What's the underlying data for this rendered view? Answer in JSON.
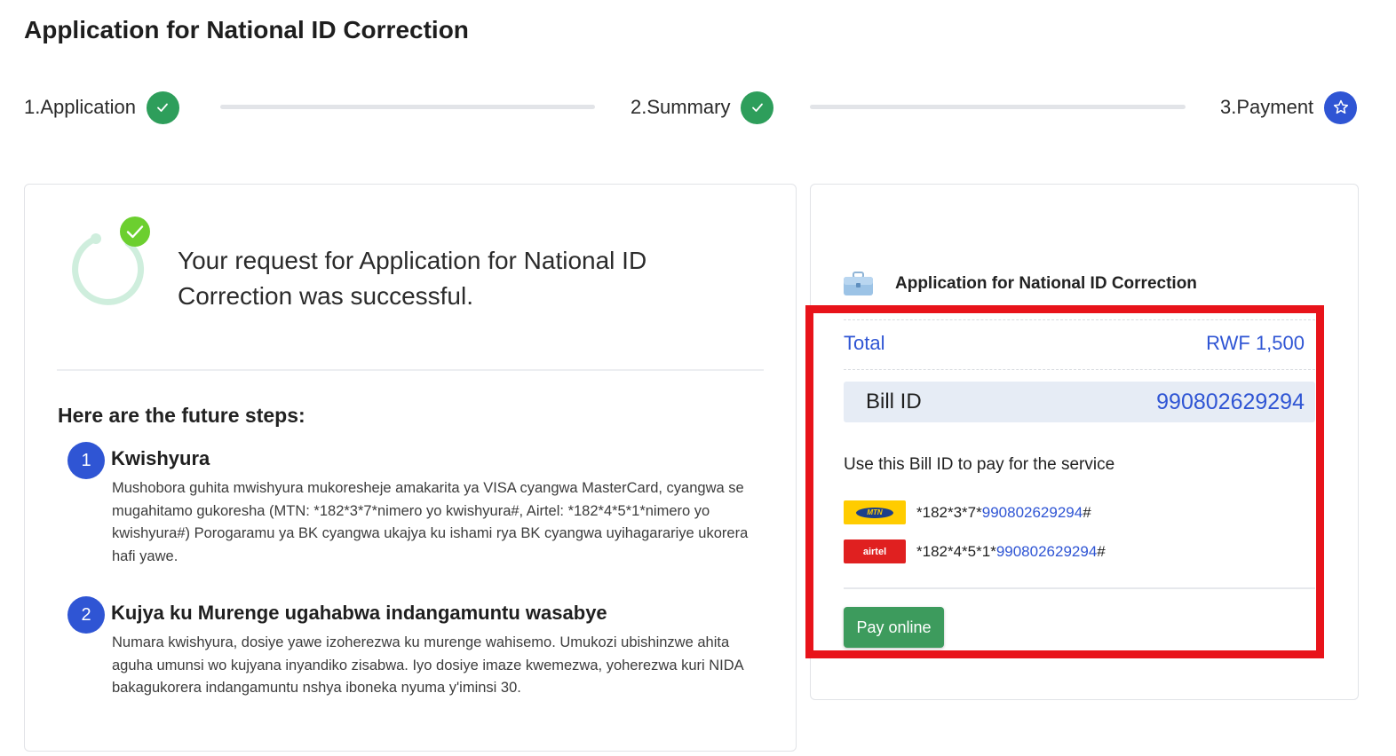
{
  "page": {
    "title": "Application for National ID Correction"
  },
  "stepper": {
    "steps": [
      {
        "label": "1.Application",
        "status": "done",
        "icon": "check-icon"
      },
      {
        "label": "2.Summary",
        "status": "done",
        "icon": "check-icon"
      },
      {
        "label": "3.Payment",
        "status": "current",
        "icon": "star-icon"
      }
    ]
  },
  "success": {
    "message": "Your request for Application for National ID Correction was successful."
  },
  "future": {
    "title": "Here are the future steps:",
    "steps": [
      {
        "number": "1",
        "title": "Kwishyura",
        "body": "Mushobora guhita mwishyura mukoresheje amakarita ya VISA cyangwa MasterCard, cyangwa se mugahitamo gukoresha (MTN: *182*3*7*nimero yo kwishyura#, Airtel: *182*4*5*1*nimero yo kwishyura#) Porogaramu ya BK cyangwa ukajya ku ishami rya BK cyangwa uyihagarariye ukorera hafi yawe."
      },
      {
        "number": "2",
        "title": "Kujya ku Murenge ugahabwa indangamuntu wasabye",
        "body": "Numara kwishyura, dosiye yawe izoherezwa ku murenge wahisemo. Umukozi ubishinzwe ahita aguha umunsi wo kujyana inyandiko zisabwa. Iyo dosiye imaze kwemezwa, yoherezwa kuri NIDA bakagukorera indangamuntu nshya iboneka nyuma y'iminsi 30."
      }
    ]
  },
  "payment": {
    "service_name": "Application for National ID Correction",
    "total_label": "Total",
    "total_value": "RWF 1,500",
    "bill_label": "Bill ID",
    "bill_value": "990802629294",
    "use_text": "Use this Bill ID to pay for the service",
    "mtn": {
      "logo_text": "MTN",
      "prefix": "*182*3*7*",
      "number": "990802629294",
      "suffix": "#"
    },
    "airtel": {
      "logo_text": "airtel",
      "prefix": "*182*4*5*1*",
      "number": "990802629294",
      "suffix": "#"
    },
    "pay_button": "Pay online"
  },
  "colors": {
    "primary": "#2f55d4",
    "success": "#2e9e5b",
    "highlight": "#e8131a",
    "mtn": "#ffcc00",
    "airtel": "#e02020"
  }
}
